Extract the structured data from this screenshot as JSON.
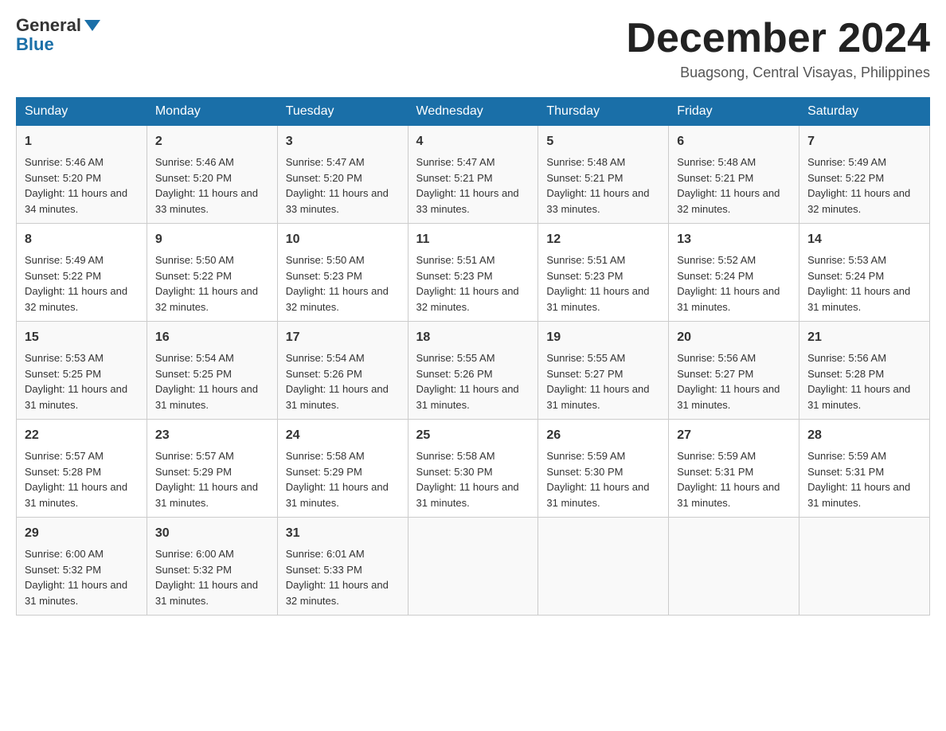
{
  "header": {
    "logo_general": "General",
    "logo_blue": "Blue",
    "month_title": "December 2024",
    "location": "Buagsong, Central Visayas, Philippines"
  },
  "days_of_week": [
    "Sunday",
    "Monday",
    "Tuesday",
    "Wednesday",
    "Thursday",
    "Friday",
    "Saturday"
  ],
  "weeks": [
    [
      {
        "day": "1",
        "sunrise": "Sunrise: 5:46 AM",
        "sunset": "Sunset: 5:20 PM",
        "daylight": "Daylight: 11 hours and 34 minutes."
      },
      {
        "day": "2",
        "sunrise": "Sunrise: 5:46 AM",
        "sunset": "Sunset: 5:20 PM",
        "daylight": "Daylight: 11 hours and 33 minutes."
      },
      {
        "day": "3",
        "sunrise": "Sunrise: 5:47 AM",
        "sunset": "Sunset: 5:20 PM",
        "daylight": "Daylight: 11 hours and 33 minutes."
      },
      {
        "day": "4",
        "sunrise": "Sunrise: 5:47 AM",
        "sunset": "Sunset: 5:21 PM",
        "daylight": "Daylight: 11 hours and 33 minutes."
      },
      {
        "day": "5",
        "sunrise": "Sunrise: 5:48 AM",
        "sunset": "Sunset: 5:21 PM",
        "daylight": "Daylight: 11 hours and 33 minutes."
      },
      {
        "day": "6",
        "sunrise": "Sunrise: 5:48 AM",
        "sunset": "Sunset: 5:21 PM",
        "daylight": "Daylight: 11 hours and 32 minutes."
      },
      {
        "day": "7",
        "sunrise": "Sunrise: 5:49 AM",
        "sunset": "Sunset: 5:22 PM",
        "daylight": "Daylight: 11 hours and 32 minutes."
      }
    ],
    [
      {
        "day": "8",
        "sunrise": "Sunrise: 5:49 AM",
        "sunset": "Sunset: 5:22 PM",
        "daylight": "Daylight: 11 hours and 32 minutes."
      },
      {
        "day": "9",
        "sunrise": "Sunrise: 5:50 AM",
        "sunset": "Sunset: 5:22 PM",
        "daylight": "Daylight: 11 hours and 32 minutes."
      },
      {
        "day": "10",
        "sunrise": "Sunrise: 5:50 AM",
        "sunset": "Sunset: 5:23 PM",
        "daylight": "Daylight: 11 hours and 32 minutes."
      },
      {
        "day": "11",
        "sunrise": "Sunrise: 5:51 AM",
        "sunset": "Sunset: 5:23 PM",
        "daylight": "Daylight: 11 hours and 32 minutes."
      },
      {
        "day": "12",
        "sunrise": "Sunrise: 5:51 AM",
        "sunset": "Sunset: 5:23 PM",
        "daylight": "Daylight: 11 hours and 31 minutes."
      },
      {
        "day": "13",
        "sunrise": "Sunrise: 5:52 AM",
        "sunset": "Sunset: 5:24 PM",
        "daylight": "Daylight: 11 hours and 31 minutes."
      },
      {
        "day": "14",
        "sunrise": "Sunrise: 5:53 AM",
        "sunset": "Sunset: 5:24 PM",
        "daylight": "Daylight: 11 hours and 31 minutes."
      }
    ],
    [
      {
        "day": "15",
        "sunrise": "Sunrise: 5:53 AM",
        "sunset": "Sunset: 5:25 PM",
        "daylight": "Daylight: 11 hours and 31 minutes."
      },
      {
        "day": "16",
        "sunrise": "Sunrise: 5:54 AM",
        "sunset": "Sunset: 5:25 PM",
        "daylight": "Daylight: 11 hours and 31 minutes."
      },
      {
        "day": "17",
        "sunrise": "Sunrise: 5:54 AM",
        "sunset": "Sunset: 5:26 PM",
        "daylight": "Daylight: 11 hours and 31 minutes."
      },
      {
        "day": "18",
        "sunrise": "Sunrise: 5:55 AM",
        "sunset": "Sunset: 5:26 PM",
        "daylight": "Daylight: 11 hours and 31 minutes."
      },
      {
        "day": "19",
        "sunrise": "Sunrise: 5:55 AM",
        "sunset": "Sunset: 5:27 PM",
        "daylight": "Daylight: 11 hours and 31 minutes."
      },
      {
        "day": "20",
        "sunrise": "Sunrise: 5:56 AM",
        "sunset": "Sunset: 5:27 PM",
        "daylight": "Daylight: 11 hours and 31 minutes."
      },
      {
        "day": "21",
        "sunrise": "Sunrise: 5:56 AM",
        "sunset": "Sunset: 5:28 PM",
        "daylight": "Daylight: 11 hours and 31 minutes."
      }
    ],
    [
      {
        "day": "22",
        "sunrise": "Sunrise: 5:57 AM",
        "sunset": "Sunset: 5:28 PM",
        "daylight": "Daylight: 11 hours and 31 minutes."
      },
      {
        "day": "23",
        "sunrise": "Sunrise: 5:57 AM",
        "sunset": "Sunset: 5:29 PM",
        "daylight": "Daylight: 11 hours and 31 minutes."
      },
      {
        "day": "24",
        "sunrise": "Sunrise: 5:58 AM",
        "sunset": "Sunset: 5:29 PM",
        "daylight": "Daylight: 11 hours and 31 minutes."
      },
      {
        "day": "25",
        "sunrise": "Sunrise: 5:58 AM",
        "sunset": "Sunset: 5:30 PM",
        "daylight": "Daylight: 11 hours and 31 minutes."
      },
      {
        "day": "26",
        "sunrise": "Sunrise: 5:59 AM",
        "sunset": "Sunset: 5:30 PM",
        "daylight": "Daylight: 11 hours and 31 minutes."
      },
      {
        "day": "27",
        "sunrise": "Sunrise: 5:59 AM",
        "sunset": "Sunset: 5:31 PM",
        "daylight": "Daylight: 11 hours and 31 minutes."
      },
      {
        "day": "28",
        "sunrise": "Sunrise: 5:59 AM",
        "sunset": "Sunset: 5:31 PM",
        "daylight": "Daylight: 11 hours and 31 minutes."
      }
    ],
    [
      {
        "day": "29",
        "sunrise": "Sunrise: 6:00 AM",
        "sunset": "Sunset: 5:32 PM",
        "daylight": "Daylight: 11 hours and 31 minutes."
      },
      {
        "day": "30",
        "sunrise": "Sunrise: 6:00 AM",
        "sunset": "Sunset: 5:32 PM",
        "daylight": "Daylight: 11 hours and 31 minutes."
      },
      {
        "day": "31",
        "sunrise": "Sunrise: 6:01 AM",
        "sunset": "Sunset: 5:33 PM",
        "daylight": "Daylight: 11 hours and 32 minutes."
      },
      null,
      null,
      null,
      null
    ]
  ]
}
